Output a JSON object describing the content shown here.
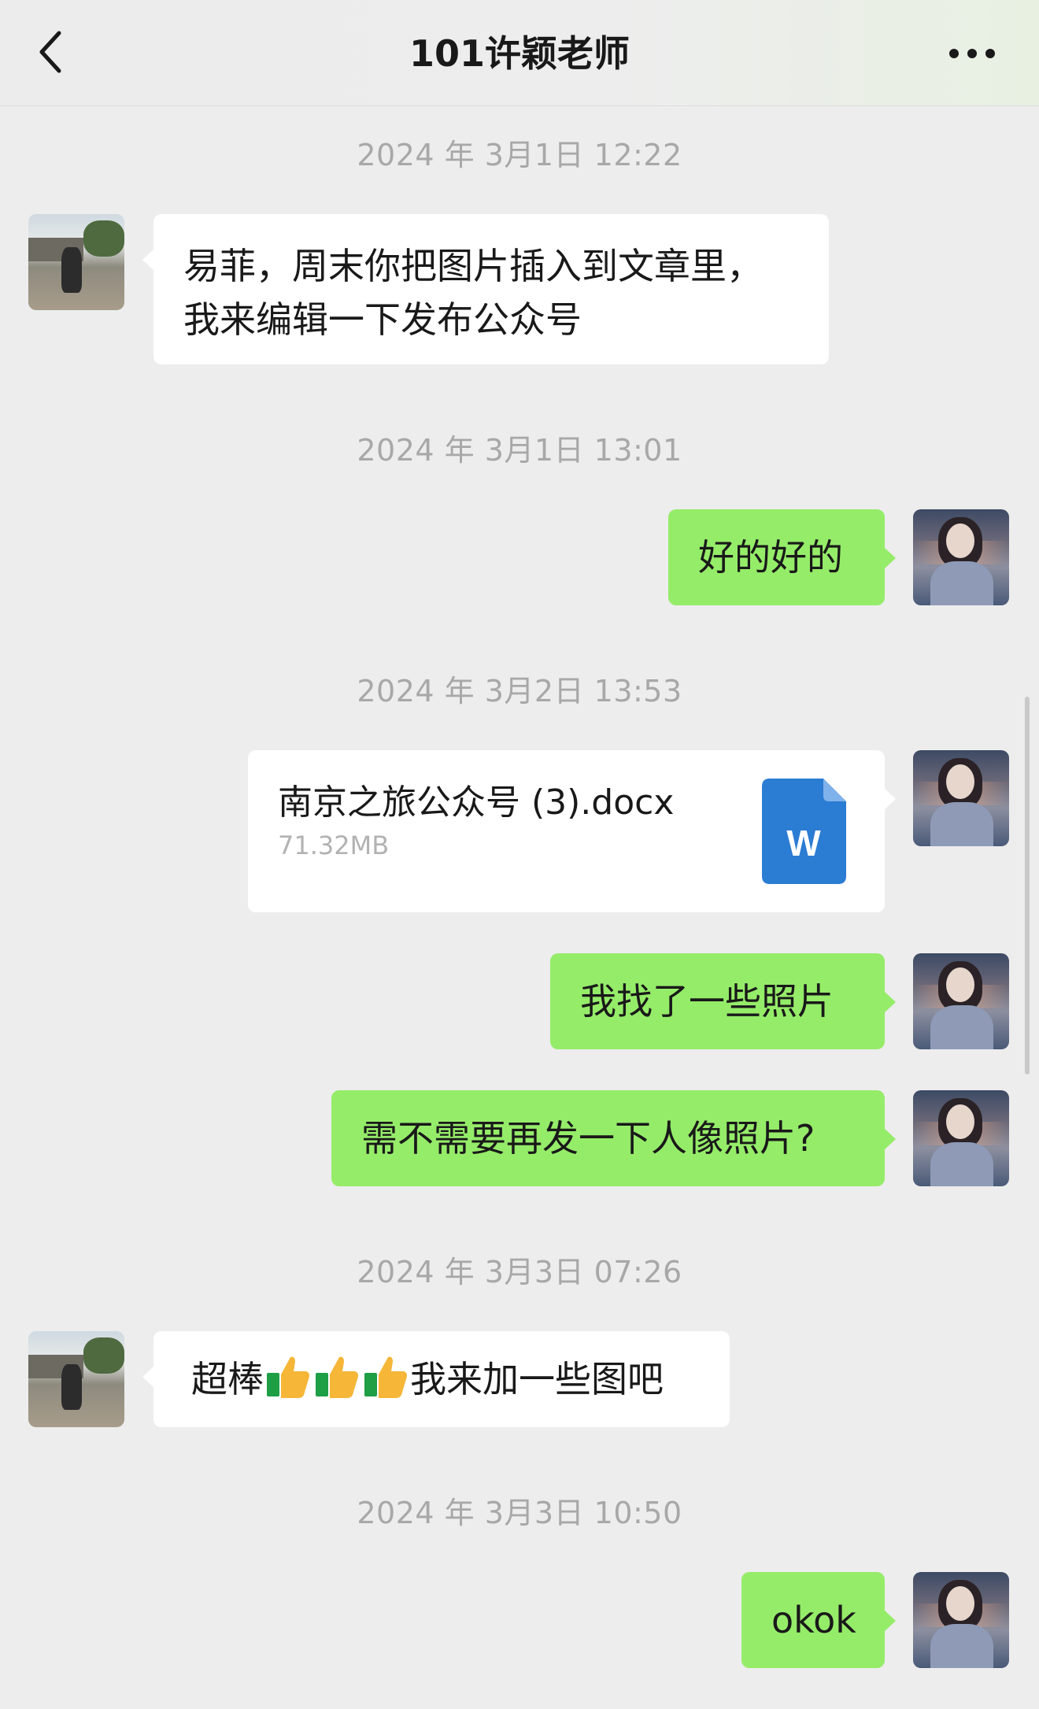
{
  "header": {
    "title": "101许颖老师",
    "back_icon": "chevron-left-icon",
    "more_icon": "ellipsis-icon"
  },
  "timestamps": [
    "2024 年 3月1日 12:22",
    "2024 年 3月1日 13:01",
    "2024 年 3月2日 13:53",
    "2024 年 3月3日 07:26",
    "2024 年 3月3日 10:50"
  ],
  "messages": {
    "m1_line1": "易菲，周末你把图片插入到文章里，",
    "m1_line2": "我来编辑一下发布公众号",
    "m2": "好的好的",
    "file": {
      "name": "南京之旅公众号 (3).docx",
      "size": "71.32MB",
      "icon_letter": "W"
    },
    "m4": "我找了一些照片",
    "m5": "需不需要再发一下人像照片?",
    "m6_prefix": "超棒",
    "m6_suffix": "我来加一些图吧",
    "m7": "okok"
  },
  "colors": {
    "background": "#ededed",
    "my_bubble": "#95ec69",
    "other_bubble": "#ffffff",
    "timestamp_text": "#a8a8a8",
    "word_icon": "#2b7cd3"
  }
}
